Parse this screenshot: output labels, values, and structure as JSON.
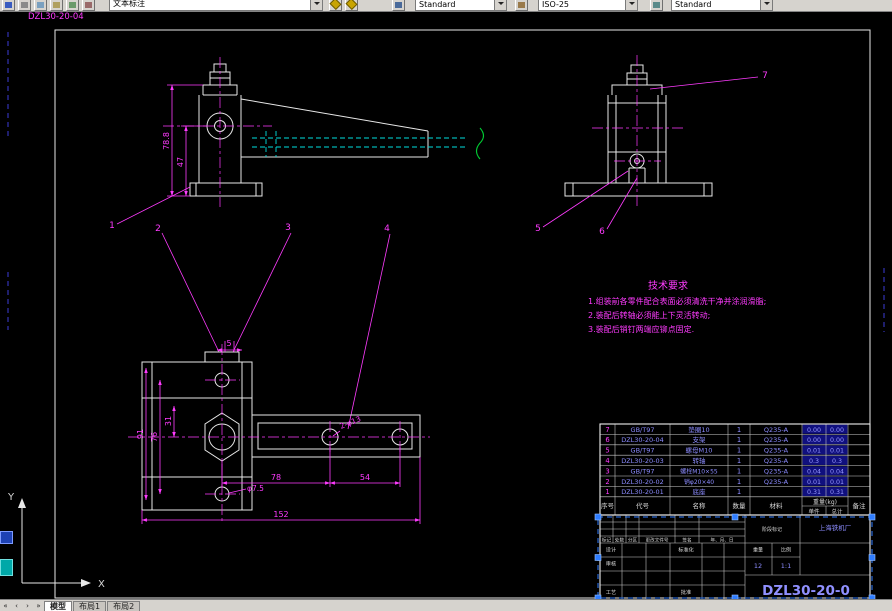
{
  "toolbar": {
    "text_style": "文本标注",
    "dim_style": "Standard",
    "tolerance_style": "ISO-25",
    "table_style": "Standard"
  },
  "drawing": {
    "sheet_label": "DZL30-20-04",
    "tech_req": {
      "title": "技术要求",
      "line1": "1.组装前各零件配合表面必须清洗干净并涂润滑脂;",
      "line2": "2.装配后转轴必须能上下灵活转动;",
      "line3": "3.装配后销钉两端应铆点固定."
    },
    "dims": {
      "side_height": "78.8",
      "side_hole": "47",
      "top_len": "152",
      "top_a": "78",
      "top_b": "54",
      "top_h1": "91",
      "top_h2": "76",
      "top_h3": "31",
      "top_s": "5",
      "hole_small": "φ7.5",
      "hole_pair": "2-φ13"
    },
    "balloons": {
      "b1": "1",
      "b2": "2",
      "b3": "3",
      "b4": "4",
      "b5": "5",
      "b6": "6",
      "b7": "7"
    }
  },
  "bom": {
    "headers": {
      "no": "序号",
      "code": "代号",
      "name": "名称",
      "qty": "数量",
      "mat": "材料",
      "weight": "重量(kg)",
      "unit": "单件",
      "total": "总计",
      "note": "备注"
    },
    "rows": [
      {
        "no": "7",
        "code": "GB/T97",
        "name": "垫圈10",
        "qty": "1",
        "mat": "Q235-A",
        "unit": "0.00",
        "total": "0.00"
      },
      {
        "no": "6",
        "code": "DZL30-20-04",
        "name": "支架",
        "qty": "1",
        "mat": "Q235-A",
        "unit": "0.00",
        "total": "0.00"
      },
      {
        "no": "5",
        "code": "GB/T97",
        "name": "螺母M10",
        "qty": "1",
        "mat": "Q235-A",
        "unit": "0.01",
        "total": "0.01"
      },
      {
        "no": "4",
        "code": "DZL30-20-03",
        "name": "转轴",
        "qty": "1",
        "mat": "Q235-A",
        "unit": "0.3",
        "total": "0.3"
      },
      {
        "no": "3",
        "code": "GB/T97",
        "name": "螺栓M10×55",
        "qty": "1",
        "mat": "Q235-A",
        "unit": "0.04",
        "total": "0.04"
      },
      {
        "no": "2",
        "code": "DZL30-20-02",
        "name": "销φ20×40",
        "qty": "1",
        "mat": "Q235-A",
        "unit": "0.01",
        "total": "0.01"
      },
      {
        "no": "1",
        "code": "DZL30-20-01",
        "name": "底座",
        "qty": "1",
        "mat": "",
        "unit": "0.31",
        "total": "0.31"
      }
    ]
  },
  "titleblock": {
    "rev": {
      "mark": "标记",
      "count": "处数",
      "zone": "分区",
      "doc": "更改文件号",
      "sign": "签名",
      "date": "年、月、日"
    },
    "sig": {
      "design": "设计",
      "review": "审核",
      "process": "工艺",
      "standard": "标准化",
      "approve": "批准"
    },
    "stage_label": "阶段标记",
    "weight_label": "重量",
    "scale_label": "比例",
    "weight_value": "12",
    "scale_value": "1:1",
    "company": "上海铁机厂",
    "part_no": "DZL30-20-0"
  },
  "ucs": {
    "x": "X",
    "y": "Y"
  },
  "tabbar": {
    "nav": [
      "«",
      "‹",
      "›",
      "»"
    ],
    "tabs": {
      "model": "模型",
      "layout1": "布局1",
      "layout2": "布局2"
    }
  },
  "colors": {
    "geometry": "#e8e8e8",
    "dimension": "#ff3bff",
    "hidden": "#00dede",
    "break_line": "#00cc33",
    "bom_text": "#8c8cff",
    "selection": "#2f7dff",
    "canvas": "#000000",
    "chrome": "#d6d3ce"
  }
}
